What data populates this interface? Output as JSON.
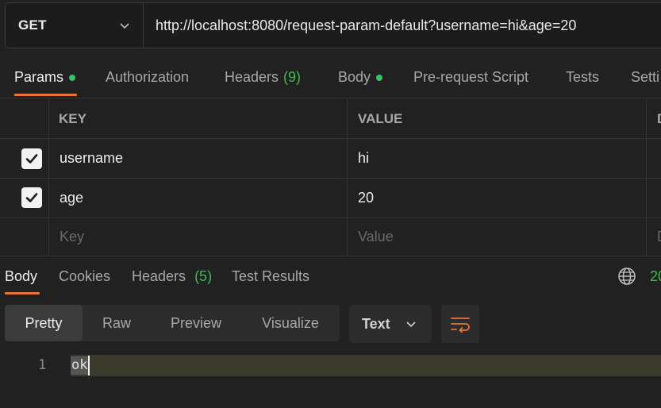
{
  "request": {
    "method": "GET",
    "url": "http://localhost:8080/request-param-default?username=hi&age=20"
  },
  "request_tabs": [
    {
      "label": "Params",
      "dot": true,
      "active": true
    },
    {
      "label": "Authorization"
    },
    {
      "label": "Headers",
      "count": "(9)"
    },
    {
      "label": "Body",
      "dot": true
    },
    {
      "label": "Pre-request Script"
    },
    {
      "label": "Tests"
    },
    {
      "label": "Setti"
    }
  ],
  "params": {
    "columns": [
      "KEY",
      "VALUE",
      "D"
    ],
    "rows": [
      {
        "checked": true,
        "key": "username",
        "value": "hi"
      },
      {
        "checked": true,
        "key": "age",
        "value": "20"
      }
    ],
    "placeholder_key": "Key",
    "placeholder_value": "Value",
    "placeholder_desc": "D"
  },
  "response_tabs": [
    {
      "label": "Body",
      "active": true
    },
    {
      "label": "Cookies"
    },
    {
      "label": "Headers",
      "count": "(5)"
    },
    {
      "label": "Test Results"
    }
  ],
  "response_status": "20",
  "view_modes": [
    "Pretty",
    "Raw",
    "Preview",
    "Visualize"
  ],
  "active_view": "Pretty",
  "format": "Text",
  "body_lines": [
    {
      "num": "1",
      "text": "ok"
    }
  ],
  "colors": {
    "accent": "#e8733f",
    "success": "#3fb950",
    "dot": "#36c46a"
  },
  "icons": [
    "chevron-down-icon",
    "checkbox-checked-icon",
    "globe-icon",
    "wrap-lines-icon"
  ]
}
